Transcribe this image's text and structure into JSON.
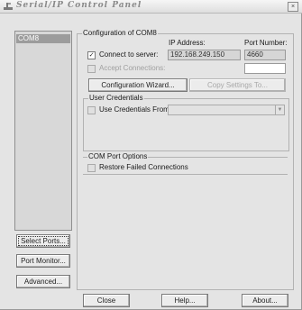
{
  "window": {
    "title": "Serial/IP Control Panel",
    "close_glyph": "×"
  },
  "ports_list": {
    "items": [
      "COM8"
    ]
  },
  "left_buttons": {
    "select_ports": "Select Ports...",
    "port_monitor": "Port Monitor...",
    "advanced": "Advanced..."
  },
  "config": {
    "group_label": "Configuration of COM8",
    "ip_address_label": "IP Address:",
    "port_number_label": "Port Number:",
    "connect_to_server": {
      "label": "Connect to server:",
      "checked": true
    },
    "ip_address": "192.168.249.150",
    "port_number": "4660",
    "accept_connections": {
      "label": "Accept Connections:",
      "checked": false
    },
    "accept_port": "",
    "configuration_wizard": "Configuration Wizard...",
    "copy_settings_to": "Copy Settings To..."
  },
  "user_credentials": {
    "group_label": "User Credentials",
    "use_credentials_from": {
      "label": "Use Credentials From:",
      "checked": false
    },
    "selected": ""
  },
  "com_port_options": {
    "group_label": "COM Port Options",
    "restore_failed_connections": {
      "label": "Restore Failed Connections",
      "checked": false
    }
  },
  "bottom_buttons": {
    "close": "Close",
    "help": "Help...",
    "about": "About..."
  },
  "icons": {
    "app": "serial-ip-app-icon",
    "checkmark": "✓",
    "dropdown": "▼"
  },
  "colors": {
    "window_bg": "#e4e4e4",
    "selection": "#9c9c9c"
  }
}
